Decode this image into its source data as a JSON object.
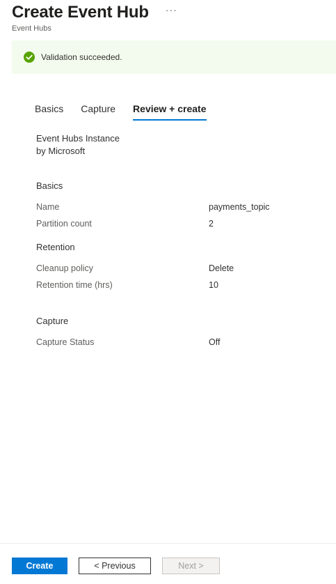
{
  "header": {
    "title": "Create Event Hub",
    "more_label": "···",
    "subtitle": "Event Hubs"
  },
  "banner": {
    "icon": "check-circle-icon",
    "text": "Validation succeeded.",
    "color": "#57a300"
  },
  "tabs": [
    {
      "label": "Basics",
      "active": false
    },
    {
      "label": "Capture",
      "active": false
    },
    {
      "label": "Review + create",
      "active": true
    }
  ],
  "instance": {
    "line1": "Event Hubs Instance",
    "line2": "by Microsoft"
  },
  "sections": {
    "basics": {
      "title": "Basics",
      "rows": [
        {
          "label": "Name",
          "value": "payments_topic"
        },
        {
          "label": "Partition count",
          "value": "2"
        }
      ]
    },
    "retention": {
      "title": "Retention",
      "rows": [
        {
          "label": "Cleanup policy",
          "value": "Delete"
        },
        {
          "label": "Retention time (hrs)",
          "value": "10"
        }
      ]
    },
    "capture": {
      "title": "Capture",
      "rows": [
        {
          "label": "Capture Status",
          "value": "Off"
        }
      ]
    }
  },
  "footer": {
    "create_label": "Create",
    "previous_label": "< Previous",
    "next_label": "Next >"
  },
  "colors": {
    "accent": "#0078d4"
  }
}
